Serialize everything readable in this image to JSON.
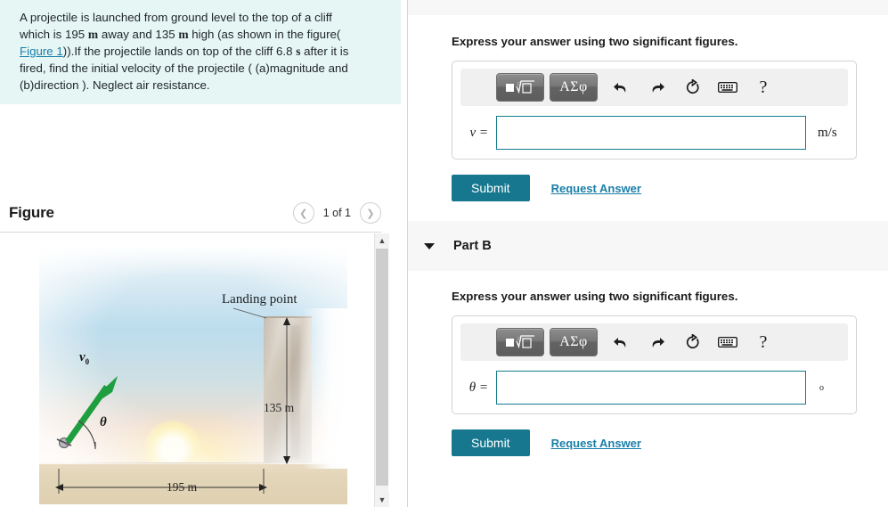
{
  "question": {
    "line1": "A projectile is launched from ground level to the top of a cliff",
    "line2_a": "which is 195 ",
    "line2_unit1": "m",
    "line2_b": " away and 135 ",
    "line2_unit2": "m",
    "line2_c": " high (as shown in the figure(",
    "figure_link": "Figure 1",
    "line3_a": ")).If the projectile lands on top of the cliff 6.8 ",
    "line3_unit": "s",
    "line3_b": " after it is",
    "line4": "fired, find the initial velocity of the projectile ( (a)magnitude and",
    "line5": "(b)direction ). Neglect air resistance."
  },
  "figure_panel": {
    "title": "Figure",
    "prev_icon": "chevron-left-icon",
    "next_icon": "chevron-right-icon",
    "pager_label": "1 of 1",
    "scrollbar": {
      "up_icon": "chevron-up-icon",
      "down_icon": "chevron-down-icon"
    }
  },
  "figure": {
    "label_v0": "v",
    "label_v0_sub": "0",
    "label_theta": "θ",
    "label_landing_point": "Landing point",
    "label_height": "135 m",
    "label_distance": "195 m"
  },
  "math_toolbar": {
    "template_button_label": "■√□",
    "greek_button_label": "ΑΣφ",
    "undo_icon": "undo-arrow-icon",
    "redo_icon": "redo-arrow-icon",
    "reset_icon": "reset-circular-arrow-icon",
    "keyboard_icon": "keyboard-icon",
    "help_label": "?"
  },
  "part_a": {
    "instructions": "Express your answer using two significant figures.",
    "variable_label": "v =",
    "input_value": "",
    "input_placeholder": "",
    "unit": "m/s",
    "submit_label": "Submit",
    "request_answer_label": "Request Answer"
  },
  "part_b": {
    "title": "Part B",
    "caret_icon": "caret-down-icon",
    "instructions": "Express your answer using two significant figures.",
    "variable_label": "θ =",
    "input_value": "",
    "input_placeholder": "",
    "unit": "o",
    "submit_label": "Submit",
    "request_answer_label": "Request Answer"
  },
  "colors": {
    "accent_teal": "#16778f",
    "link_blue": "#1a7fa8",
    "question_bg": "#e6f6f5",
    "panel_gray": "#f7f7f7",
    "vector_green": "#1f9e3f"
  }
}
